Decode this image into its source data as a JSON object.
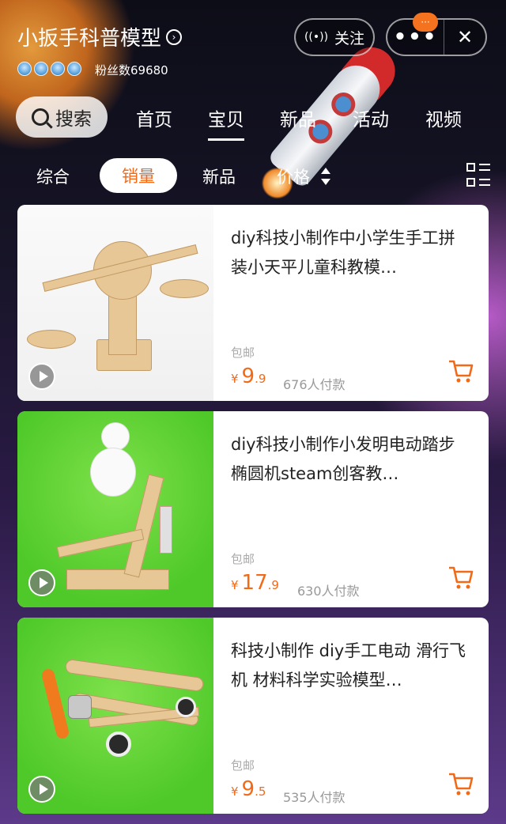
{
  "shop": {
    "name": "小扳手科普模型",
    "fans_label": "粉丝数69680",
    "crown_count": 4
  },
  "actions": {
    "follow_label": "关注",
    "follow_icon": "broadcast-icon",
    "more_icon": "more-dots-icon",
    "badge": "···",
    "close_icon": "close-icon"
  },
  "nav": {
    "search_label": "搜索",
    "tabs": [
      {
        "label": "首页",
        "active": false
      },
      {
        "label": "宝贝",
        "active": true
      },
      {
        "label": "新品",
        "active": false
      },
      {
        "label": "活动",
        "active": false
      },
      {
        "label": "视频",
        "active": false
      }
    ]
  },
  "sort": {
    "items": [
      "综合",
      "销量",
      "新品",
      "价格"
    ],
    "active": "销量",
    "layout_icon": "grid-list-icon"
  },
  "colors": {
    "accent": "#f26a18",
    "badge": "#f5731f"
  },
  "products": [
    {
      "title": "diy科技小制作中小学生手工拼装小天平儿童科教模…",
      "shipping": "包邮",
      "currency": "¥",
      "price_int": "9",
      "price_dec": ".9",
      "sold": "676人付款",
      "has_video": true
    },
    {
      "title": "diy科技小制作小发明电动踏步椭圆机steam创客教…",
      "shipping": "包邮",
      "currency": "¥",
      "price_int": "17",
      "price_dec": ".9",
      "sold": "630人付款",
      "has_video": true
    },
    {
      "title": "科技小制作 diy手工电动 滑行飞机 材料科学实验模型…",
      "shipping": "包邮",
      "currency": "¥",
      "price_int": "9",
      "price_dec": ".5",
      "sold": "535人付款",
      "has_video": true
    }
  ]
}
